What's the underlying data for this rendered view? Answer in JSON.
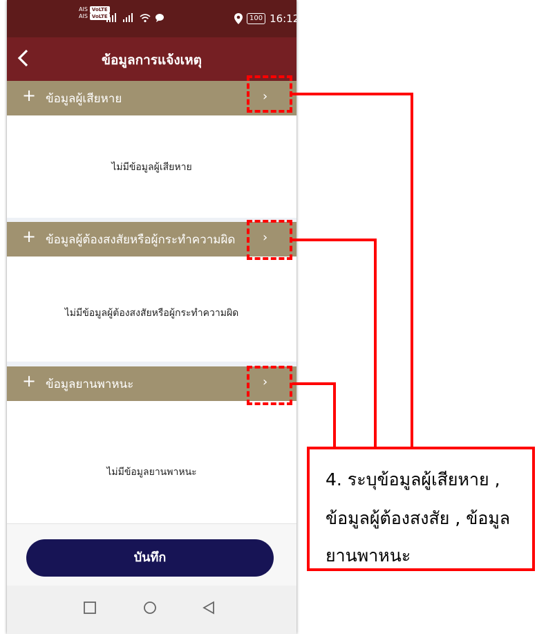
{
  "status_bar": {
    "carrier_1": "AIS",
    "carrier_2": "AIS",
    "network_badge": "VoLTE",
    "battery": "100",
    "time": "16:12",
    "icons": [
      "signal-icon",
      "wifi-icon",
      "chat-icon",
      "location-icon",
      "battery-icon"
    ]
  },
  "header": {
    "back_icon": "chevron-left-icon",
    "title": "ข้อมูลการแจ้งเหตุ"
  },
  "sections": [
    {
      "title": "ข้อมูลผู้เสียหาย",
      "empty_text": "ไม่มีข้อมูลผู้เสียหาย",
      "add_symbol": "+",
      "open_symbol": "›"
    },
    {
      "title": "ข้อมูลผู้ต้องสงสัยหรือผู้กระทำความผิด",
      "empty_text": "ไม่มีข้อมูลผู้ต้องสงสัยหรือผู้กระทำความผิด",
      "add_symbol": "+",
      "open_symbol": "›"
    },
    {
      "title": "ข้อมูลยานพาหนะ",
      "empty_text": "ไม่มีข้อมูลยานพาหนะ",
      "add_symbol": "+",
      "open_symbol": "›"
    }
  ],
  "footer": {
    "save_label": "บันทึก"
  },
  "navbar": {
    "icons": [
      "recent-apps-icon",
      "home-icon",
      "back-icon"
    ]
  },
  "callout": {
    "line_1": "4. ระบุข้อมูลผู้เสียหาย ,",
    "line_2": "ข้อมูลผู้ต้องสงสัย , ข้อมูล",
    "line_3": "ยานพาหนะ"
  },
  "colors": {
    "status_bar": "#5e1b1b",
    "header": "#751f23",
    "section_bar": "#a09270",
    "save_button": "#171455",
    "annotation": "#ff0000"
  }
}
